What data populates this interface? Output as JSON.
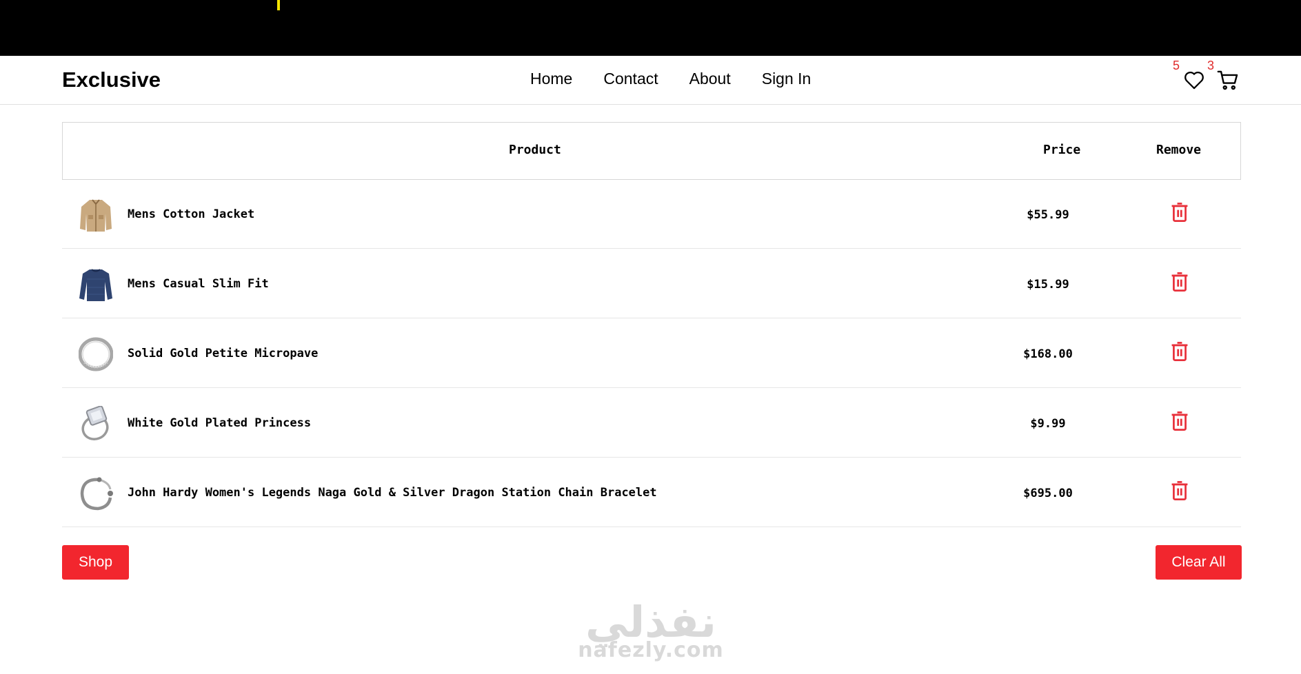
{
  "header": {
    "logo": "Exclusive",
    "nav": [
      "Home",
      "Contact",
      "About",
      "Sign In"
    ],
    "wishlist_count": "5",
    "cart_count": "3"
  },
  "table": {
    "headers": {
      "product": "Product",
      "price": "Price",
      "remove": "Remove"
    },
    "rows": [
      {
        "name": "Mens Cotton Jacket",
        "price": "$55.99",
        "image": "jacket-image"
      },
      {
        "name": "Mens Casual Slim Fit",
        "price": "$15.99",
        "image": "longsleeve-shirt-image"
      },
      {
        "name": "Solid Gold Petite Micropave",
        "price": "$168.00",
        "image": "ring-band-image"
      },
      {
        "name": "White Gold Plated Princess",
        "price": "$9.99",
        "image": "diamond-ring-image"
      },
      {
        "name": "John Hardy Women's Legends Naga Gold & Silver Dragon Station Chain Bracelet",
        "price": "$695.00",
        "image": "dragon-bracelet-image"
      }
    ]
  },
  "actions": {
    "shop": "Shop",
    "clear_all": "Clear All"
  },
  "watermark": {
    "arabic": "نفذلي",
    "latin": "nafezly.com"
  },
  "colors": {
    "accent": "#f2262e",
    "badge": "#e02b2b",
    "trash": "#e8303a"
  }
}
